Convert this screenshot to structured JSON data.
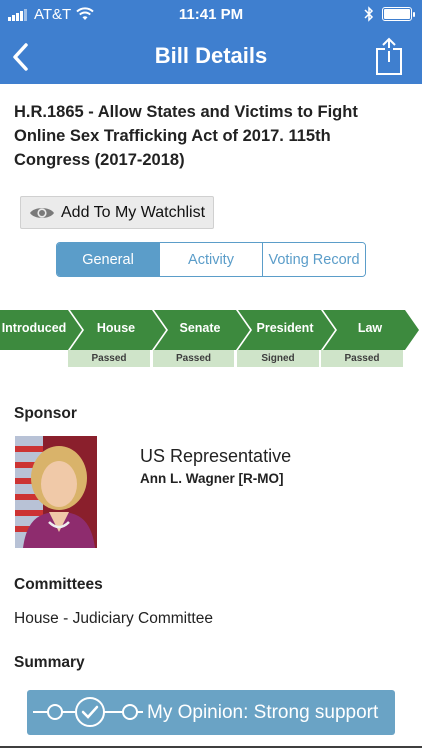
{
  "status_bar": {
    "carrier": "AT&T",
    "time": "11:41 PM"
  },
  "nav": {
    "title": "Bill Details"
  },
  "bill": {
    "title": "H.R.1865 - Allow States and Victims to Fight Online Sex Trafficking Act of 2017. 115th Congress (2017-2018)"
  },
  "watchlist": {
    "label": "Add To My Watchlist"
  },
  "tabs": [
    {
      "label": "General",
      "active": true
    },
    {
      "label": "Activity",
      "active": false
    },
    {
      "label": "Voting Record",
      "active": false
    }
  ],
  "progress": {
    "color": "#3d8a3e",
    "stages": [
      {
        "label": "Introduced",
        "status": ""
      },
      {
        "label": "House",
        "status": "Passed"
      },
      {
        "label": "Senate",
        "status": "Passed"
      },
      {
        "label": "President",
        "status": "Signed"
      },
      {
        "label": "Law",
        "status": "Passed"
      }
    ]
  },
  "sponsor": {
    "heading": "Sponsor",
    "role": "US Representative",
    "name": "Ann L. Wagner [R-MO]"
  },
  "committees": {
    "heading": "Committees",
    "value": "House - Judiciary Committee"
  },
  "summary": {
    "heading": "Summary"
  },
  "opinion": {
    "label": "My Opinion: Strong support",
    "selected_index": 1,
    "scale_points": 3
  }
}
